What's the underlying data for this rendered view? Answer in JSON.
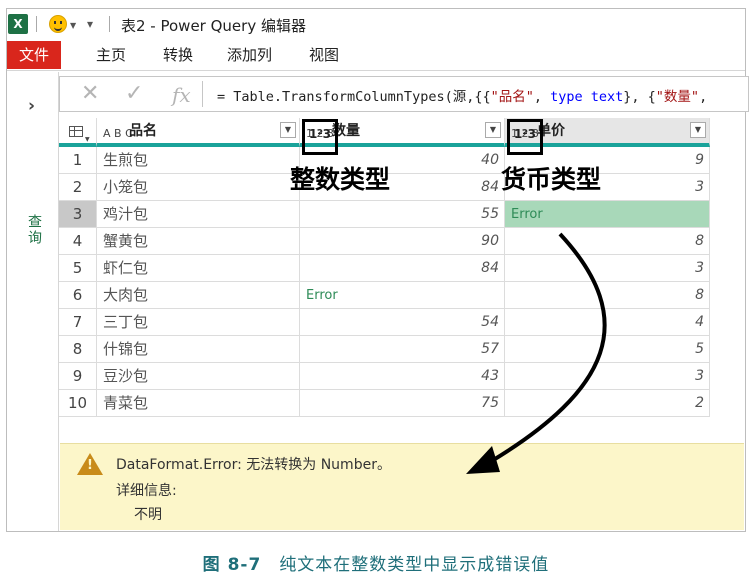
{
  "window": {
    "title": "表2 - Power Query 编辑器",
    "app_icon_letter": "X"
  },
  "ribbon": {
    "tabs": [
      "文件",
      "主页",
      "转换",
      "添加列",
      "视图"
    ]
  },
  "queries_pane": {
    "label": "查询"
  },
  "formula_bar": {
    "cancel_glyph": "✕",
    "confirm_glyph": "✓",
    "fx_label": "fx",
    "formula": {
      "p1": "= Table.TransformColumnTypes(源,{{",
      "s1": "\"品名\"",
      "p2": ", ",
      "k1": "type text",
      "p3": "}, {",
      "s2": "\"数量\"",
      "p4": ","
    }
  },
  "table": {
    "columns": [
      {
        "type_icon": "A B C",
        "label": "品名"
      },
      {
        "type_icon": "1 2 3",
        "label": "数量"
      },
      {
        "type_icon": "1 2 3",
        "label": "单价"
      }
    ],
    "rows": [
      {
        "idx": "1",
        "name": "生煎包",
        "qty": "40",
        "price": "9"
      },
      {
        "idx": "2",
        "name": "小笼包",
        "qty": "84",
        "price": "3"
      },
      {
        "idx": "3",
        "name": "鸡汁包",
        "qty": "55",
        "price": "Error"
      },
      {
        "idx": "4",
        "name": "蟹黄包",
        "qty": "90",
        "price": "8"
      },
      {
        "idx": "5",
        "name": "虾仁包",
        "qty": "84",
        "price": "3"
      },
      {
        "idx": "6",
        "name": "大肉包",
        "qty": "Error",
        "price": "8"
      },
      {
        "idx": "7",
        "name": "三丁包",
        "qty": "54",
        "price": "4"
      },
      {
        "idx": "8",
        "name": "什锦包",
        "qty": "57",
        "price": "5"
      },
      {
        "idx": "9",
        "name": "豆沙包",
        "qty": "43",
        "price": "3"
      },
      {
        "idx": "10",
        "name": "青菜包",
        "qty": "75",
        "price": "2"
      }
    ]
  },
  "annotations": {
    "qty_label": "整数类型",
    "price_label": "货币类型",
    "qty_box_text": "1²3",
    "price_box_text": "1²3"
  },
  "error_pane": {
    "message": "DataFormat.Error: 无法转换为 Number。",
    "details_label": "详细信息:",
    "details_value": "不明",
    "warn_glyph": "!"
  },
  "caption": {
    "figure": "图 8-7",
    "text": "纯文本在整数类型中显示成错误值"
  },
  "colors": {
    "file_tab": "#d9261c",
    "accent_teal": "#1aa39a",
    "error_cell": "#a8d8b9",
    "error_pane": "#fcf6c9",
    "caption": "#1f6f7a"
  }
}
